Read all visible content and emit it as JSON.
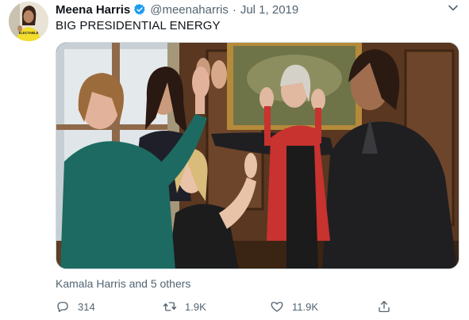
{
  "author": {
    "name": "Meena Harris",
    "handle": "@meenaharris",
    "separator": "·",
    "date": "Jul 1, 2019",
    "avatar_shirt_text": "ELECTABLE"
  },
  "tweet": {
    "text": "BIG PRESIDENTIAL ENERGY"
  },
  "media": {
    "tagged_people": "Kamala Harris and 5 others"
  },
  "actions": {
    "reply_count": "314",
    "retweet_count": "1.9K",
    "like_count": "11.9K"
  },
  "icons": {
    "verified": "verified-badge-icon",
    "caret": "chevron-down-icon",
    "reply": "reply-icon",
    "retweet": "retweet-icon",
    "like": "heart-icon",
    "share": "share-icon"
  },
  "colors": {
    "verified_blue": "#1d9bf0",
    "secondary_text": "#536471",
    "primary_text": "#0f1419"
  }
}
